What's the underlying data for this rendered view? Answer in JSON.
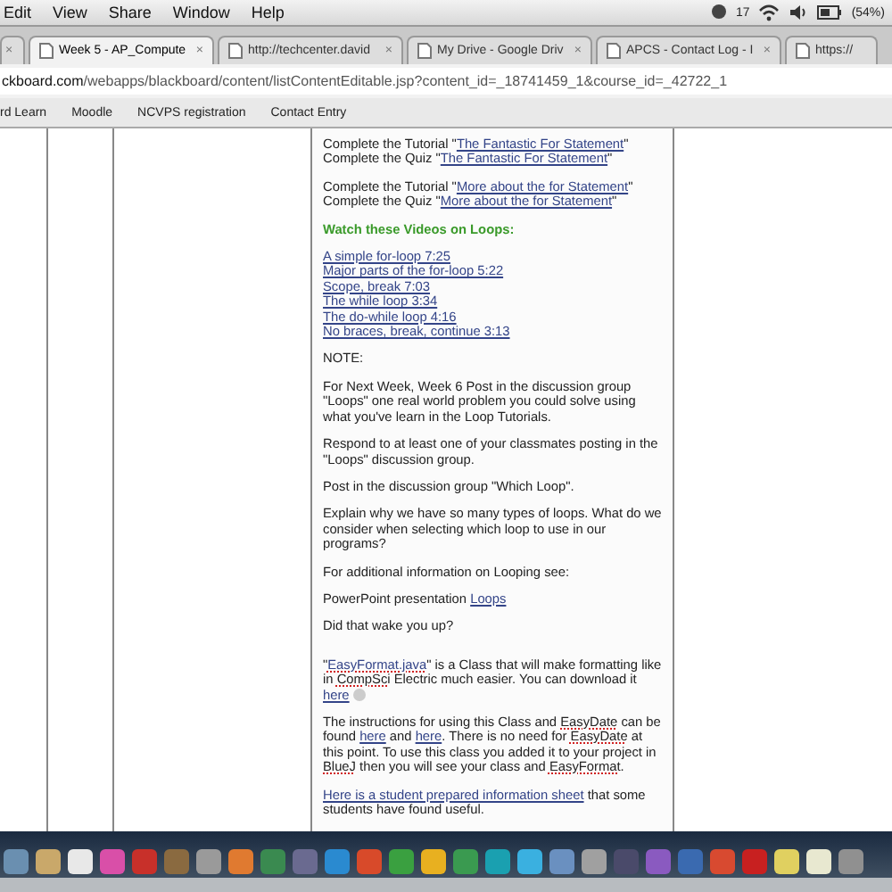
{
  "menu_bar": {
    "items": [
      "Edit",
      "View",
      "Share",
      "Window",
      "Help"
    ],
    "status": {
      "count": "17",
      "battery": "(54%)"
    }
  },
  "tabs": [
    {
      "close": "×",
      "selected": false
    },
    {
      "label": "Week 5 - AP_Compute",
      "close": "×",
      "selected": true
    },
    {
      "label": "http://techcenter.david",
      "close": "×",
      "selected": false
    },
    {
      "label": "My Drive - Google Driv",
      "close": "×",
      "selected": false
    },
    {
      "label": "APCS - Contact Log - I",
      "close": "×",
      "selected": false
    },
    {
      "label": "https://",
      "selected": false
    }
  ],
  "address": {
    "host": "ckboard.com",
    "path": "/webapps/blackboard/content/listContentEditable.jsp?content_id=_18741459_1&course_id=_42722_1"
  },
  "bookmarks": [
    "rd Learn",
    "Moodle",
    "NCVPS registration",
    "Contact Entry"
  ],
  "content": [
    {
      "kind": "para",
      "lines": [
        [
          {
            "t": "Complete the Tutorial \""
          },
          {
            "t": "The Fantastic For Statement",
            "kind": "link"
          },
          {
            "t": "\""
          }
        ],
        [
          {
            "t": "Complete the Quiz \""
          },
          {
            "t": "The Fantastic For Statement",
            "kind": "link"
          },
          {
            "t": "\""
          }
        ]
      ]
    },
    {
      "kind": "para",
      "lines": [
        [
          {
            "t": "Complete the Tutorial \""
          },
          {
            "t": "More about the for Statement",
            "kind": "link"
          },
          {
            "t": "\""
          }
        ],
        [
          {
            "t": "Complete the Quiz \""
          },
          {
            "t": "More about the for Statement",
            "kind": "link"
          },
          {
            "t": "\""
          }
        ]
      ]
    },
    {
      "kind": "heading",
      "text": "Watch these Videos on Loops:"
    },
    {
      "kind": "links",
      "items": [
        "A simple for-loop  7:25",
        "Major parts of the for-loop  5:22",
        "Scope, break  7:03",
        "The while loop  3:34",
        "The do-while loop  4:16",
        "No braces, break, continue  3:13"
      ]
    },
    {
      "kind": "para",
      "lines": [
        [
          {
            "t": "NOTE:"
          }
        ]
      ]
    },
    {
      "kind": "para",
      "lines": [
        [
          {
            "t": "For Next Week, Week 6 Post in the discussion group \"Loops\" one real world problem you could solve using what you've learn in the Loop Tutorials."
          }
        ]
      ]
    },
    {
      "kind": "para",
      "lines": [
        [
          {
            "t": "Respond to at least one of your classmates posting in the \"Loops\" discussion group."
          }
        ]
      ]
    },
    {
      "kind": "para",
      "lines": [
        [
          {
            "t": "Post in the discussion group \"Which Loop\"."
          }
        ]
      ]
    },
    {
      "kind": "para",
      "lines": [
        [
          {
            "t": "Explain why we have so many types of loops. What do we consider when selecting which loop to use in our programs?"
          }
        ]
      ]
    },
    {
      "kind": "para",
      "lines": [
        [
          {
            "t": "For additional information on Looping see:"
          }
        ]
      ]
    },
    {
      "kind": "para",
      "lines": [
        [
          {
            "t": "PowerPoint presentation "
          },
          {
            "t": "Loops",
            "kind": "link"
          }
        ]
      ]
    },
    {
      "kind": "para",
      "lines": [
        [
          {
            "t": "Did that wake you up?"
          }
        ]
      ]
    },
    {
      "kind": "spacer"
    },
    {
      "kind": "para",
      "lines": [
        [
          {
            "t": "\""
          },
          {
            "t": "EasyFormat.java",
            "kind": "spell-link"
          },
          {
            "t": "\" is a Class that will make formatting like in "
          },
          {
            "t": "CompSci",
            "kind": "spell"
          },
          {
            "t": " Electric much easier. You can download it "
          },
          {
            "t": "here",
            "kind": "link"
          },
          {
            "kind": "icon"
          }
        ]
      ]
    },
    {
      "kind": "para",
      "lines": [
        [
          {
            "t": "The instructions for using this Class and "
          },
          {
            "t": "EasyDate",
            "kind": "spell"
          },
          {
            "t": " can be found "
          },
          {
            "t": "here",
            "kind": "link"
          },
          {
            "t": " and "
          },
          {
            "t": "here",
            "kind": "link"
          },
          {
            "t": ". There is no need for "
          },
          {
            "t": "EasyDate",
            "kind": "spell"
          },
          {
            "t": " at this point. To use this class you added it to your project in "
          },
          {
            "t": "BlueJ",
            "kind": "spell"
          },
          {
            "t": " then you will see your class and "
          },
          {
            "t": "EasyFormat",
            "kind": "spell"
          },
          {
            "t": "."
          }
        ]
      ]
    },
    {
      "kind": "para",
      "lines": [
        [
          {
            "t": "Here is a student prepared information sheet",
            "kind": "link"
          },
          {
            "t": " that some students have found useful."
          }
        ]
      ]
    }
  ]
}
